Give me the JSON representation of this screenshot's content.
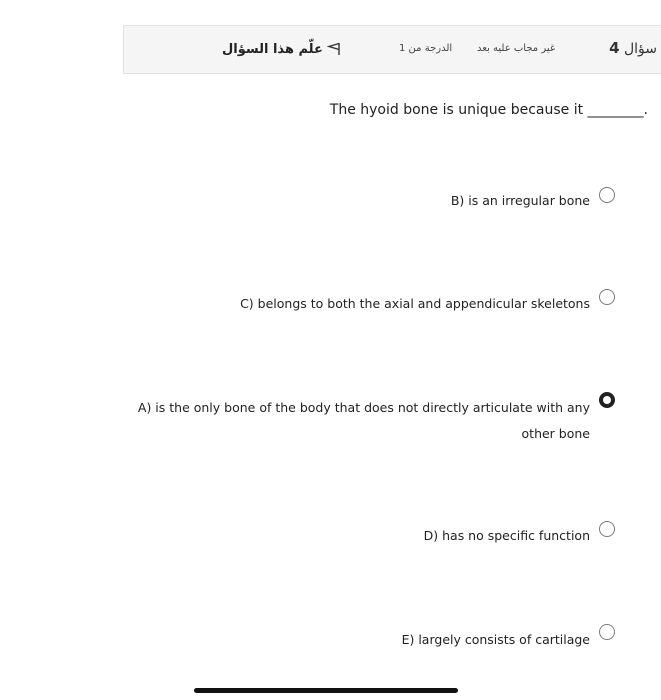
{
  "header": {
    "question_label": "سؤال",
    "question_number": "4",
    "status": "غير مجاب عليه بعد",
    "grade": "الدرجة من 1",
    "flag_label": "علّم هذا السؤال"
  },
  "question": {
    "text": "The hyoid bone is unique because it ________."
  },
  "answers": [
    {
      "text": "B) is an irregular bone",
      "selected": false
    },
    {
      "text": "C) belongs to both the axial and appendicular skeletons",
      "selected": false
    },
    {
      "text": "A) is the only bone of the body that does not directly articulate with any",
      "text2": "other bone",
      "selected": true
    },
    {
      "text": "D) has no specific function",
      "selected": false
    },
    {
      "text": "E) largely consists of cartilage",
      "selected": false
    }
  ],
  "icons": {
    "flag": "flag-icon",
    "radio": "radio-button"
  }
}
